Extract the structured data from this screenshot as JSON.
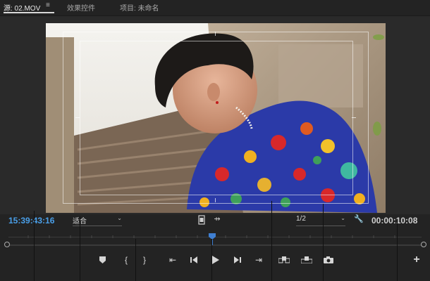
{
  "tabs": [
    {
      "label": "源: 02.MOV",
      "active": true
    },
    {
      "label": "效果控件",
      "active": false
    },
    {
      "label": "项目: 未命名",
      "active": false
    }
  ],
  "monitor": {
    "current_timecode": "15:39:43:16",
    "zoom_select": "适合",
    "resolution_select": "1/2",
    "duration_timecode": "00:00:10:08",
    "timecode_color": "#4a9fe8",
    "duration_color": "#d0d0d0"
  },
  "icons": {
    "tab_menu": "hamburger-icon",
    "safe_margins": "filmstrip-icon",
    "drop_insert": "arrows-icon",
    "settings": "wrench-icon",
    "playhead": "playhead-marker-icon"
  },
  "transport": [
    {
      "name": "add-marker-button",
      "icon": "marker-icon",
      "glyph": "⬟"
    },
    {
      "name": "mark-in-button",
      "icon": "mark-in-icon",
      "glyph": "{"
    },
    {
      "name": "mark-out-button",
      "icon": "mark-out-icon",
      "glyph": "}"
    },
    {
      "name": "go-to-in-button",
      "icon": "go-to-in-icon",
      "glyph": "⇤"
    },
    {
      "name": "step-back-button",
      "icon": "step-back-icon",
      "glyph": "◀"
    },
    {
      "name": "play-button",
      "icon": "play-icon",
      "glyph": "▶"
    },
    {
      "name": "step-forward-button",
      "icon": "step-forward-icon",
      "glyph": "▶"
    },
    {
      "name": "go-to-out-button",
      "icon": "go-to-out-icon",
      "glyph": "⇥"
    },
    {
      "name": "insert-button",
      "icon": "insert-icon",
      "glyph": "⊞"
    },
    {
      "name": "overwrite-button",
      "icon": "overwrite-icon",
      "glyph": "⊟"
    },
    {
      "name": "export-frame-button",
      "icon": "camera-icon",
      "glyph": "📷"
    },
    {
      "name": "add-button",
      "icon": "plus-icon",
      "glyph": "+"
    }
  ],
  "colors": {
    "background": "#232323",
    "accent_blue": "#4a9fe8",
    "text": "#d0d0d0"
  }
}
